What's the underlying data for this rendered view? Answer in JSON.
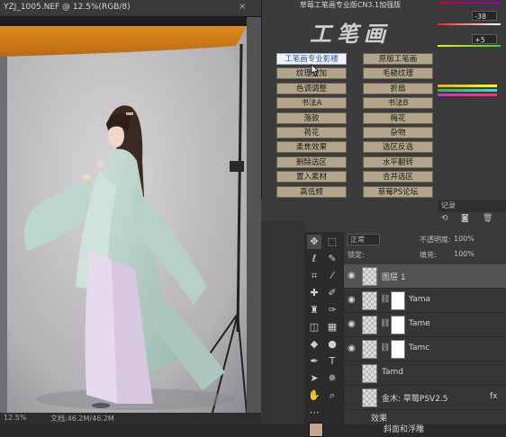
{
  "document": {
    "tab_title": "YZJ_1005.NEF @ 12.5%(RGB/8)",
    "close_glyph": "×",
    "zoom": "12.5%",
    "doc_info": "文档:46.2M/46.2M"
  },
  "plugin": {
    "title": "草莓工笔画专业版CN3.1加强版",
    "logo": "工笔画",
    "buttons": [
      {
        "label": "工笔画专业影楼",
        "active": true
      },
      {
        "label": "原版工笔画",
        "active": false
      },
      {
        "label": "纹理叠加",
        "active": false
      },
      {
        "label": "毛糙纹理",
        "active": false
      },
      {
        "label": "色调调整",
        "active": false
      },
      {
        "label": "折扇",
        "active": false
      },
      {
        "label": "书法A",
        "active": false
      },
      {
        "label": "书法B",
        "active": false
      },
      {
        "label": "落款",
        "active": false
      },
      {
        "label": "梅花",
        "active": false
      },
      {
        "label": "荷花",
        "active": false
      },
      {
        "label": "杂物",
        "active": false
      },
      {
        "label": "柔焦效果",
        "active": false
      },
      {
        "label": "选区反选",
        "active": false
      },
      {
        "label": "删除选区",
        "active": false
      },
      {
        "label": "水平翻转",
        "active": false
      },
      {
        "label": "置入素材",
        "active": false
      },
      {
        "label": "合并选区",
        "active": false
      },
      {
        "label": "高低频",
        "active": false
      },
      {
        "label": "草莓PS论坛",
        "active": false
      }
    ]
  },
  "color_panel": {
    "value1": "-38",
    "value2": "+5"
  },
  "layers": {
    "tab_label": "记录",
    "blend_mode": "正常",
    "opacity_label": "不透明度:",
    "opacity_value": "100%",
    "lock_label": "锁定:",
    "fill_label": "填充:",
    "fill_value": "100%",
    "items": [
      {
        "name": "图层 1",
        "visible": true,
        "selected": true
      },
      {
        "name": "Yama",
        "visible": true,
        "selected": false
      },
      {
        "name": "Tame",
        "visible": true,
        "selected": false
      },
      {
        "name": "Tamc",
        "visible": true,
        "selected": false
      },
      {
        "name": "Tamd",
        "visible": false,
        "selected": false
      },
      {
        "name": "金木: 草莓PSV2.5",
        "visible": false,
        "selected": false
      }
    ],
    "effects_label": "效果",
    "effect_item": "斜面和浮雕",
    "fx_label": "fx"
  },
  "colors": {
    "accent_blue": "#2050c8",
    "button_tan": "#b2a58c",
    "foreground_swatch": "#c6a48f"
  }
}
